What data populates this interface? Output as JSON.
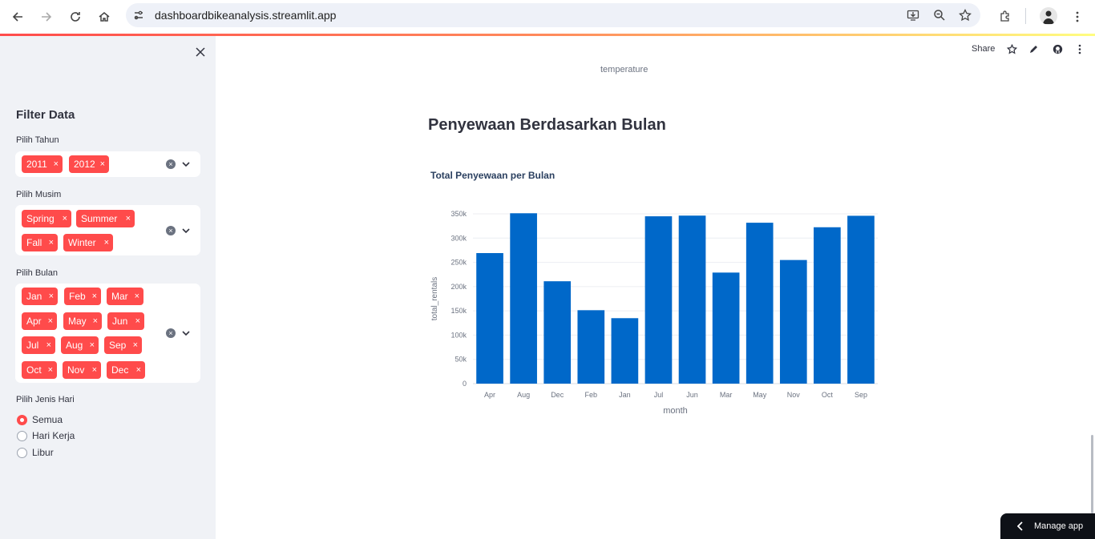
{
  "browser": {
    "url": "dashboardbikeanalysis.streamlit.app"
  },
  "sidebar": {
    "title": "Filter Data",
    "year": {
      "label": "Pilih Tahun",
      "chips": [
        "2011",
        "2012"
      ]
    },
    "season": {
      "label": "Pilih Musim",
      "chips": [
        "Spring",
        "Summer",
        "Fall",
        "Winter"
      ]
    },
    "month": {
      "label": "Pilih Bulan",
      "chips": [
        "Jan",
        "Feb",
        "Mar",
        "Apr",
        "May",
        "Jun",
        "Jul",
        "Aug",
        "Sep",
        "Oct",
        "Nov",
        "Dec"
      ]
    },
    "daytype": {
      "label": "Pilih Jenis Hari",
      "options": [
        "Semua",
        "Hari Kerja",
        "Libur"
      ],
      "selected": "Semua"
    },
    "chip_remove_glyph": "×"
  },
  "toolbar": {
    "share_label": "Share"
  },
  "main": {
    "caption_top": "temperature",
    "section_title": "Penyewaan Berdasarkan Bulan",
    "chart_title": "Total Penyewaan per Bulan"
  },
  "chart_data": {
    "type": "bar",
    "title": "Total Penyewaan per Bulan",
    "xlabel": "month",
    "ylabel": "total_rentals",
    "categories": [
      "Apr",
      "Aug",
      "Dec",
      "Feb",
      "Jan",
      "Jul",
      "Jun",
      "Mar",
      "May",
      "Nov",
      "Oct",
      "Sep"
    ],
    "values": [
      269094,
      351194,
      211036,
      151352,
      134933,
      344948,
      346342,
      228920,
      331686,
      254831,
      322352,
      345991
    ],
    "ylim": [
      0,
      350000
    ],
    "yticks": [
      0,
      50000,
      100000,
      150000,
      200000,
      250000,
      300000,
      350000
    ],
    "ytick_labels": [
      "0",
      "50k",
      "100k",
      "150k",
      "200k",
      "250k",
      "300k",
      "350k"
    ],
    "bar_color": "#0068c9",
    "grid": true
  },
  "manage_app": {
    "label": "Manage app"
  }
}
